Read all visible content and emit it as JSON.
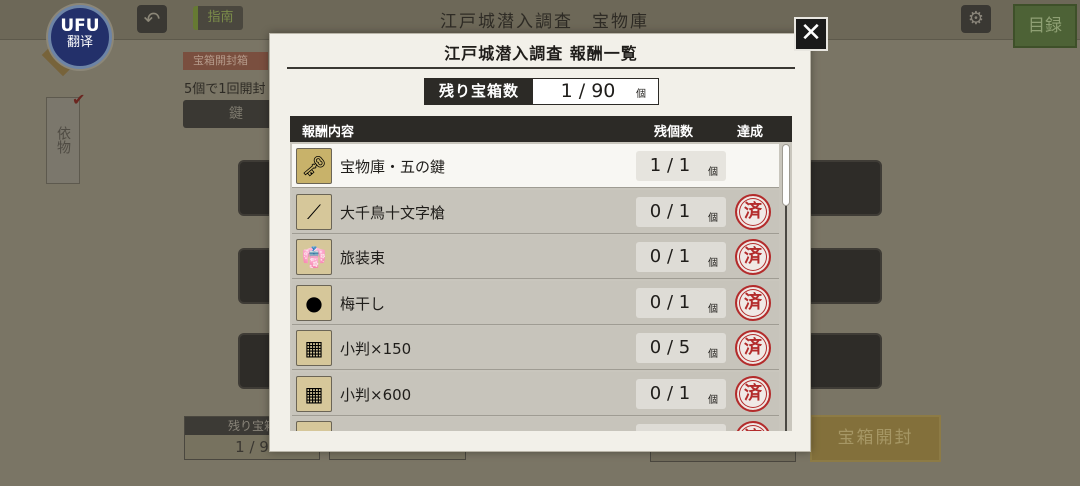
{
  "background": {
    "title": "江戸城潜入調査　宝物庫",
    "guide_label": "指南",
    "index_label": "目録",
    "translate_logo": "UFU",
    "translate_label": "翻译",
    "tag_label": "宝箱開封箱",
    "info_text": "5個で1回開封",
    "key_label": "鍵",
    "side_tab_label": "依物",
    "remain_title": "残り宝箱",
    "remain_value": "1 / 9",
    "open_button_label": "宝箱開封"
  },
  "modal": {
    "title": "江戸城潜入調査 報酬一覧",
    "close_symbol": "✕",
    "remain": {
      "label": "残り宝箱数",
      "value": "1 / 90",
      "unit": "個"
    },
    "table": {
      "headers": {
        "name": "報酬内容",
        "count": "残個数",
        "done": "達成"
      },
      "rows": [
        {
          "name": "宝物庫・五の鍵",
          "count": "1 / 1",
          "unit": "個",
          "icon": "key-icon",
          "glyph": "🗝",
          "icon_bg": "#c8b26a",
          "done": "",
          "highlight": true
        },
        {
          "name": "大千鳥十文字槍",
          "count": "0 / 1",
          "unit": "個",
          "icon": "spear-icon",
          "glyph": "⟋",
          "icon_bg": "#d6c79a",
          "done": "済",
          "highlight": false
        },
        {
          "name": "旅装束",
          "count": "0 / 1",
          "unit": "個",
          "icon": "garment-icon",
          "glyph": "👘",
          "icon_bg": "#d6c79a",
          "done": "済",
          "highlight": false
        },
        {
          "name": "梅干し",
          "count": "0 / 1",
          "unit": "個",
          "icon": "umeboshi-icon",
          "glyph": "●",
          "icon_bg": "#d6c79a",
          "done": "済",
          "highlight": false
        },
        {
          "name": "小判×150",
          "count": "0 / 5",
          "unit": "個",
          "icon": "gold-coins-icon",
          "glyph": "▦",
          "icon_bg": "#d6c79a",
          "done": "済",
          "highlight": false
        },
        {
          "name": "小判×600",
          "count": "0 / 1",
          "unit": "個",
          "icon": "gold-coins-icon",
          "glyph": "▦",
          "icon_bg": "#d6c79a",
          "done": "済",
          "highlight": false
        },
        {
          "name": "",
          "count": "",
          "unit": "",
          "icon": "gold-coins-icon",
          "glyph": "▦",
          "icon_bg": "#d6c79a",
          "done": "済",
          "highlight": false
        }
      ]
    }
  },
  "colors": {
    "stamp_red": "#b32b2b",
    "header_dark": "#2c2a26",
    "modal_bg": "#f2f0e9"
  }
}
